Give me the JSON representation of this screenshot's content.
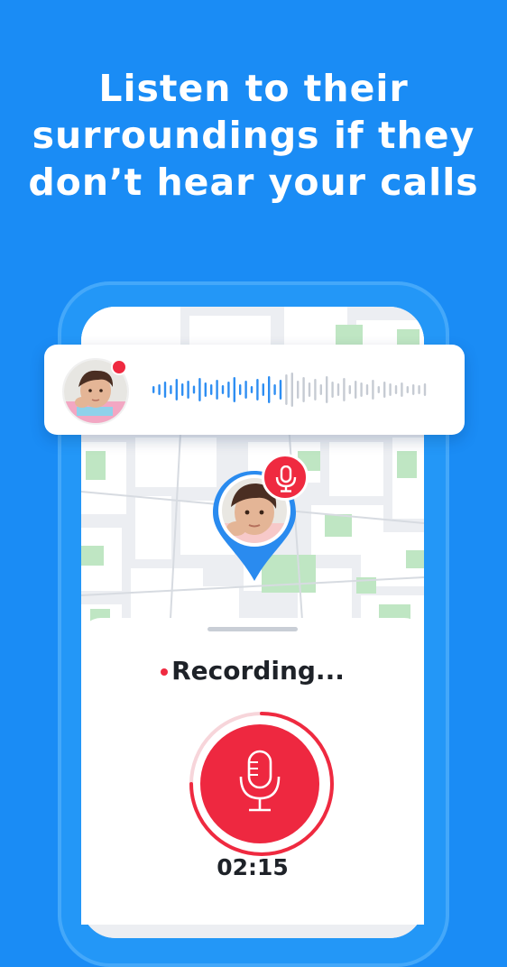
{
  "headline": {
    "line1": "Listen to their",
    "line2": "surroundings if they",
    "line3": "don’t hear your calls"
  },
  "colors": {
    "background": "#1a8cf5",
    "accent_red": "#ef2a40",
    "played_wave": "#2e8ef2",
    "unplayed_wave": "#c6cbd3",
    "map_block": "#ffffff",
    "map_park": "#bfe6c3"
  },
  "audio_card": {
    "avatar_icon": "child-avatar",
    "live_indicator": "red-dot",
    "playback_progress": 0.48
  },
  "map": {
    "pin_icon": "location-pin-with-child-avatar",
    "badge_icon": "microphone-icon"
  },
  "recording": {
    "status_label": "Recording...",
    "timer": "02:15",
    "button_icon": "microphone-icon",
    "progress_ring": 0.75
  }
}
